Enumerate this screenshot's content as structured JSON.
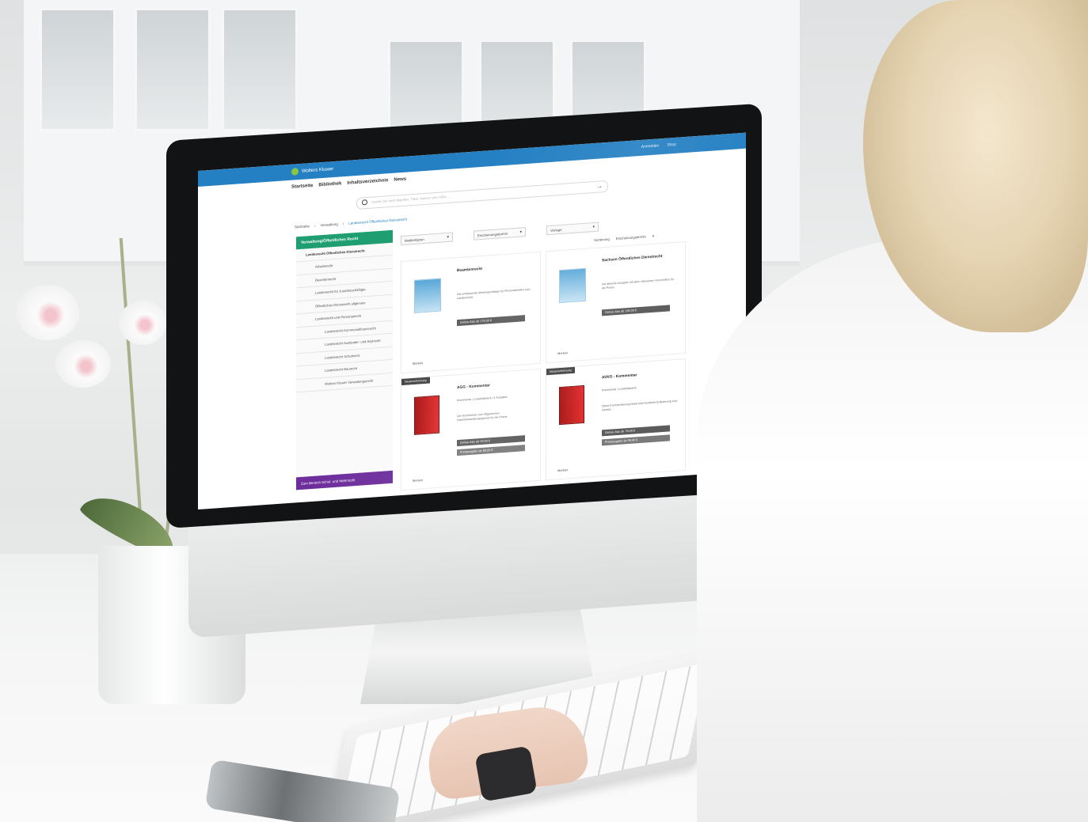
{
  "brand": {
    "name": "Wolters Kluwer",
    "accent": "#2580c3",
    "logo_color": "#8cc63f"
  },
  "top_actions": [
    "Anmelden",
    "Shop"
  ],
  "nav": [
    "Startseite",
    "Bibliothek",
    "Inhaltsverzeichnis",
    "News"
  ],
  "search": {
    "placeholder": "Suchen Sie nach Begriffen, Titeln, Autoren oder ISBN ..."
  },
  "breadcrumb": [
    "Startseite",
    "Verwaltung",
    "Landesrecht Öffentliches Dienstrecht"
  ],
  "sidebar": {
    "title": "Verwaltung/Öffentliches Recht",
    "items": [
      {
        "label": "Landesrecht Öffentliches Dienstrecht",
        "level": 1
      },
      {
        "label": "Arbeitsrecht",
        "level": 2
      },
      {
        "label": "Beamtenrecht",
        "level": 2
      },
      {
        "label": "Landesrecht für Justizbeschäftigte",
        "level": 2
      },
      {
        "label": "Öffentliches Dienstrecht allgemein",
        "level": 2
      },
      {
        "label": "Landesrecht und Personalrecht",
        "level": 2
      },
      {
        "label": "Landesrecht Kommunalfinanzrecht",
        "level": 3
      },
      {
        "label": "Landesrecht Ausländer- und Asylrecht",
        "level": 3
      },
      {
        "label": "Landesrecht Schulrecht",
        "level": 3
      },
      {
        "label": "Landesrecht Baurecht",
        "level": 3
      },
      {
        "label": "Wolters Kluwer Verwaltungsrecht",
        "level": 3
      }
    ],
    "cta": "Zum Bereich Schul- und Wehrrecht"
  },
  "filters": [
    {
      "label": "Medientypen"
    },
    {
      "label": "Erscheinungstermin"
    },
    {
      "label": "Verlage"
    }
  ],
  "sort": {
    "label": "Sortierung",
    "value": "Erscheinungstermin"
  },
  "products": [
    {
      "badge": "",
      "title": "Beamtenrecht",
      "subtitle": "",
      "description": "Die umfassende Arbeitsgrundlage für Personalstellen zum Landesrecht.",
      "prices": [
        "Online-Abo ab 179,00 €"
      ],
      "cover": "blue",
      "merken": "Merken"
    },
    {
      "badge": "",
      "title": "Sachsen Öffentliches Dienstrecht",
      "subtitle": "",
      "description": "Die aktuelle Ausgabe mit allen relevanten Vorschriften für die Praxis.",
      "prices": [
        "Online-Abo ab 149,00 €"
      ],
      "cover": "blue",
      "merken": "Merken"
    },
    {
      "badge": "Neuerscheinung",
      "title": "AGG - Kommentar",
      "subtitle": "Kommentar | Loseblattwerk | 1 Ausgabe",
      "description": "Der Kommentar zum Allgemeinen Gleichbehandlungsgesetz für die Praxis.",
      "prices": [
        "Online-Abo ab 59,00 €",
        "Printausgabe ab 89,00 €"
      ],
      "cover": "red",
      "merken": "Merken"
    },
    {
      "badge": "Neuerscheinung",
      "title": "AVKG - Kommentar",
      "subtitle": "Kommentar | Loseblattwerk",
      "description": "Diese Kommentierung bietet eine fundierte Erläuterung zum Gesetz.",
      "prices": [
        "Online-Abo ab 79,00 €",
        "Printausgabe ab 99,00 €"
      ],
      "cover": "red",
      "merken": "Merken"
    }
  ]
}
